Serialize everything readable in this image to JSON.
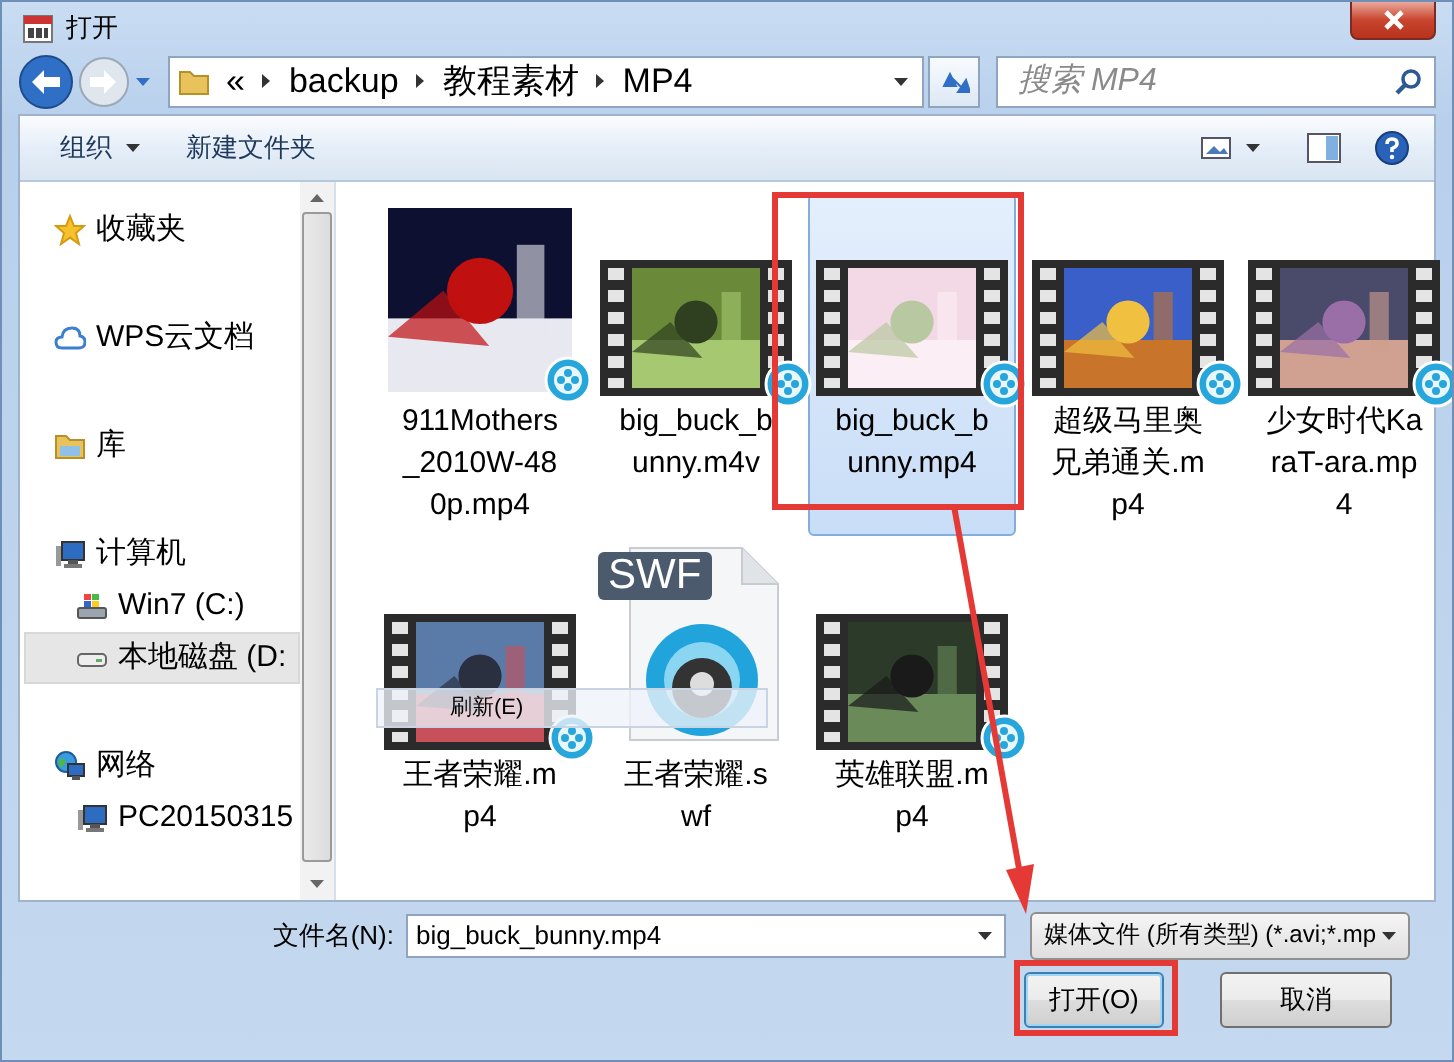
{
  "window": {
    "title": "打开"
  },
  "address": {
    "prefix": "«",
    "path": [
      "backup",
      "教程素材",
      "MP4"
    ]
  },
  "search": {
    "placeholder": "搜索 MP4"
  },
  "toolbar": {
    "organize": "组织",
    "new_folder": "新建文件夹"
  },
  "nav": [
    {
      "label": "收藏夹",
      "kind": "favorites",
      "selected": false
    },
    {
      "label": "WPS云文档",
      "kind": "cloud",
      "selected": false
    },
    {
      "label": "库",
      "kind": "library",
      "selected": false
    },
    {
      "label": "计算机",
      "kind": "computer",
      "selected": false,
      "children": [
        {
          "label": "Win7 (C:)",
          "kind": "system-drive",
          "selected": false
        },
        {
          "label": "本地磁盘 (D:",
          "kind": "drive",
          "selected": true
        }
      ]
    },
    {
      "label": "网络",
      "kind": "network",
      "selected": false,
      "children": [
        {
          "label": "PC20150315",
          "kind": "pc",
          "selected": false
        }
      ]
    }
  ],
  "files": [
    {
      "name": "911Mothers_2010W-480p.mp4",
      "kind": "cover",
      "selected": false
    },
    {
      "name": "big_buck_bunny.m4v",
      "kind": "video",
      "selected": false
    },
    {
      "name": "big_buck_bunny.mp4",
      "kind": "video",
      "selected": true
    },
    {
      "name": "超级马里奥兄弟通关.mp4",
      "kind": "video",
      "selected": false
    },
    {
      "name": "少女时代KaraT-ara.mp4",
      "kind": "video",
      "selected": false
    },
    {
      "name": "王者荣耀.mp4",
      "kind": "video",
      "selected": false
    },
    {
      "name": "王者荣耀.swf",
      "kind": "swf",
      "badge": "SWF",
      "selected": false
    },
    {
      "name": "英雄联盟.mp4",
      "kind": "video",
      "selected": false
    }
  ],
  "popup": {
    "label": "刷新(E)"
  },
  "filename": {
    "label": "文件名(N):",
    "value": "big_buck_bunny.mp4"
  },
  "filetype": {
    "value": "媒体文件 (所有类型) (*.avi;*.mp"
  },
  "buttons": [
    {
      "label": "打开(O)",
      "kind": "open"
    },
    {
      "label": "取消",
      "kind": "cancel"
    }
  ]
}
